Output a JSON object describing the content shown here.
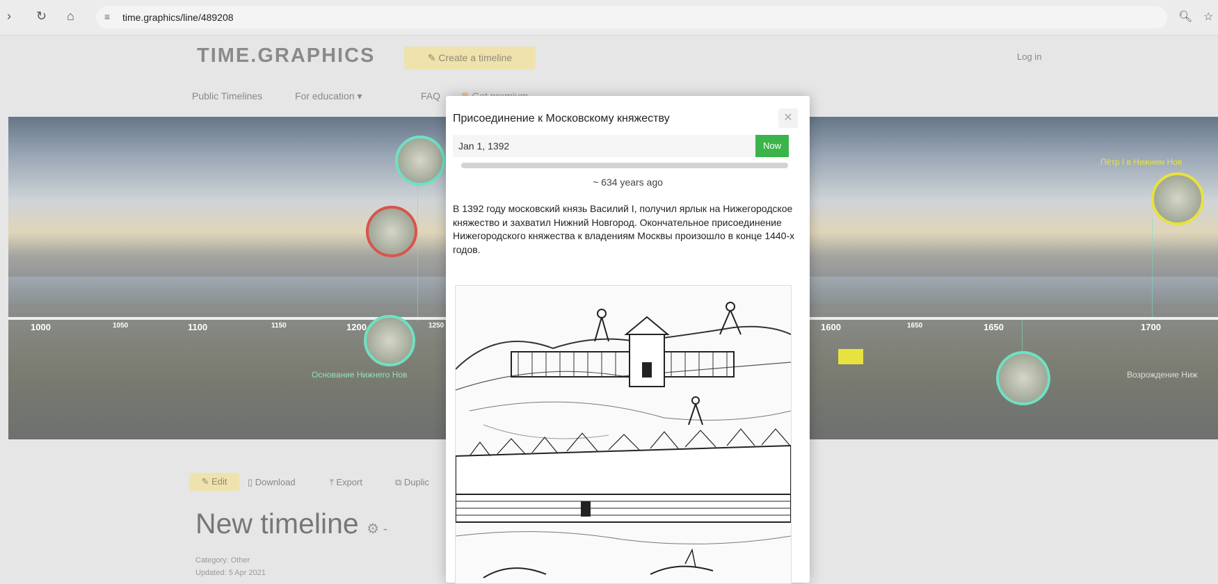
{
  "browser": {
    "url": "time.graphics/line/489208"
  },
  "header": {
    "logo": "TIME.GRAPHICS",
    "create_button": "Create a timeline",
    "login": "Log in",
    "nav": {
      "public": "Public Timelines",
      "education": "For education",
      "faq": "FAQ",
      "premium": "Get premium"
    }
  },
  "timeline": {
    "ticks": [
      "1000",
      "1050",
      "1100",
      "1150",
      "1200",
      "1250",
      "1600",
      "1650",
      "1650",
      "1700"
    ],
    "events": {
      "top_right": "Пётр I в Нижнем Нов",
      "bottom_left": "Основание Нижнего Нов",
      "bottom_right": "Возрождение Ниж"
    }
  },
  "toolbar": {
    "edit": "Edit",
    "download": "Download",
    "export": "Export",
    "duplicate": "Duplic"
  },
  "doc": {
    "title": "New timeline",
    "category": "Category: Other",
    "updated": "Updated: 5 Apr 2021"
  },
  "popup": {
    "title": "Присоединение к Московскому княжеству",
    "date": "Jan 1, 1392",
    "now_button": "Now",
    "ago": "~ 634 years ago",
    "description": "В 1392 году московский князь Василий I, получил ярлык на Нижегородское княжество и захватил Нижний Новгород. Окончательное присоединение Нижегородского княжества к владениям Москвы произошло в конце 1440-х годов."
  },
  "colors": {
    "accent": "#efe2ad",
    "now_green": "#3bb54a",
    "event_teal": "#6fe0c4",
    "event_red": "#d9534f",
    "event_yellow": "#e8e23e"
  }
}
